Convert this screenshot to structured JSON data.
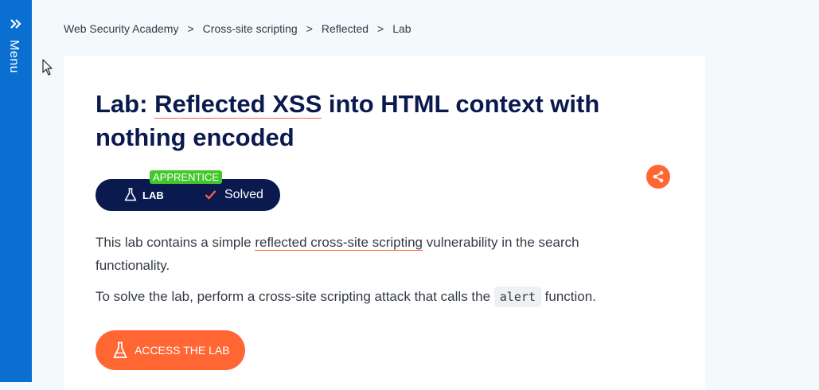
{
  "side_menu": {
    "label": "Menu"
  },
  "breadcrumb": {
    "items": [
      "Web Security Academy",
      "Cross-site scripting",
      "Reflected",
      "Lab"
    ],
    "separator": ">"
  },
  "title": {
    "prefix": "Lab: ",
    "link": "Reflected XSS",
    "suffix": " into HTML context with nothing encoded"
  },
  "badge": {
    "level": "APPRENTICE",
    "type": "LAB",
    "status": "Solved"
  },
  "description": {
    "p1_before": "This lab contains a simple ",
    "p1_link": "reflected cross-site scripting",
    "p1_after": " vulnerability in the search functionality.",
    "p2_before": "To solve the lab, perform a cross-site scripting attack that calls the ",
    "p2_code": "alert",
    "p2_after": " function."
  },
  "access_button": {
    "label": "ACCESS THE LAB"
  },
  "colors": {
    "menu_blue": "#0a6fd1",
    "navy": "#0a1a4f",
    "accent_orange": "#ff6633",
    "level_green": "#42c82c"
  },
  "icons": {
    "menu": "double-chevron-right-icon",
    "share": "share-icon",
    "lab": "flask-icon",
    "status": "checkmark-icon",
    "cursor": "mouse-pointer-icon"
  }
}
